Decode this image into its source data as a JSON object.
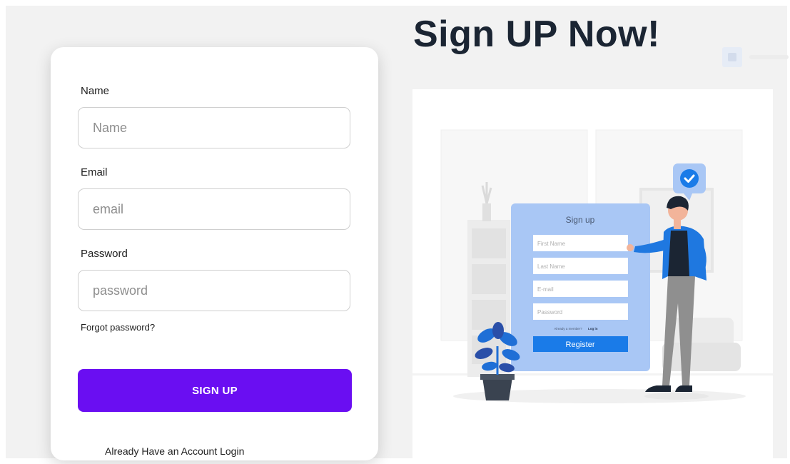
{
  "heading": "Sign UP Now!",
  "form": {
    "name_label": "Name",
    "name_placeholder": "Name",
    "email_label": "Email",
    "email_placeholder": "email",
    "password_label": "Password",
    "password_placeholder": "password",
    "forgot_link": "Forgot password?",
    "submit_label": "SIGN UP",
    "login_prompt": "Already Have an Account Login"
  },
  "illustration": {
    "form_title": "Sign up",
    "fields": [
      "First Name",
      "Last Name",
      "E-mail",
      "Password"
    ],
    "member_text": "Already a member?",
    "login_text": "Log in",
    "register_label": "Register",
    "check_icon": "check-badge-icon"
  },
  "colors": {
    "primary": "#6a0ef2",
    "heading": "#1b2533",
    "illustration_blue": "#1a7be8",
    "illustration_panel": "#a9c7f5",
    "plant_blue": "#1f6fd6"
  }
}
